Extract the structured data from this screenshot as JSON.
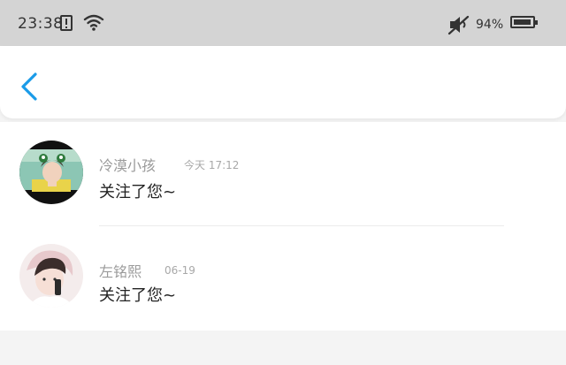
{
  "status_bar": {
    "time": "23:38",
    "alert_icon": "alert-box-icon",
    "wifi_icon": "wifi-icon",
    "mute_icon": "speaker-muted-icon",
    "battery_percent": "94%",
    "battery_level": 0.94,
    "battery_icon": "battery-icon"
  },
  "nav": {
    "back_icon": "chevron-left-icon",
    "accent_color": "#1a9be8"
  },
  "notifications": [
    {
      "name": "冷漠小孩",
      "time": "今天 17:12",
      "message": "关注了您~"
    },
    {
      "name": "左铭熙",
      "time": "06-19",
      "message": "关注了您~"
    }
  ]
}
